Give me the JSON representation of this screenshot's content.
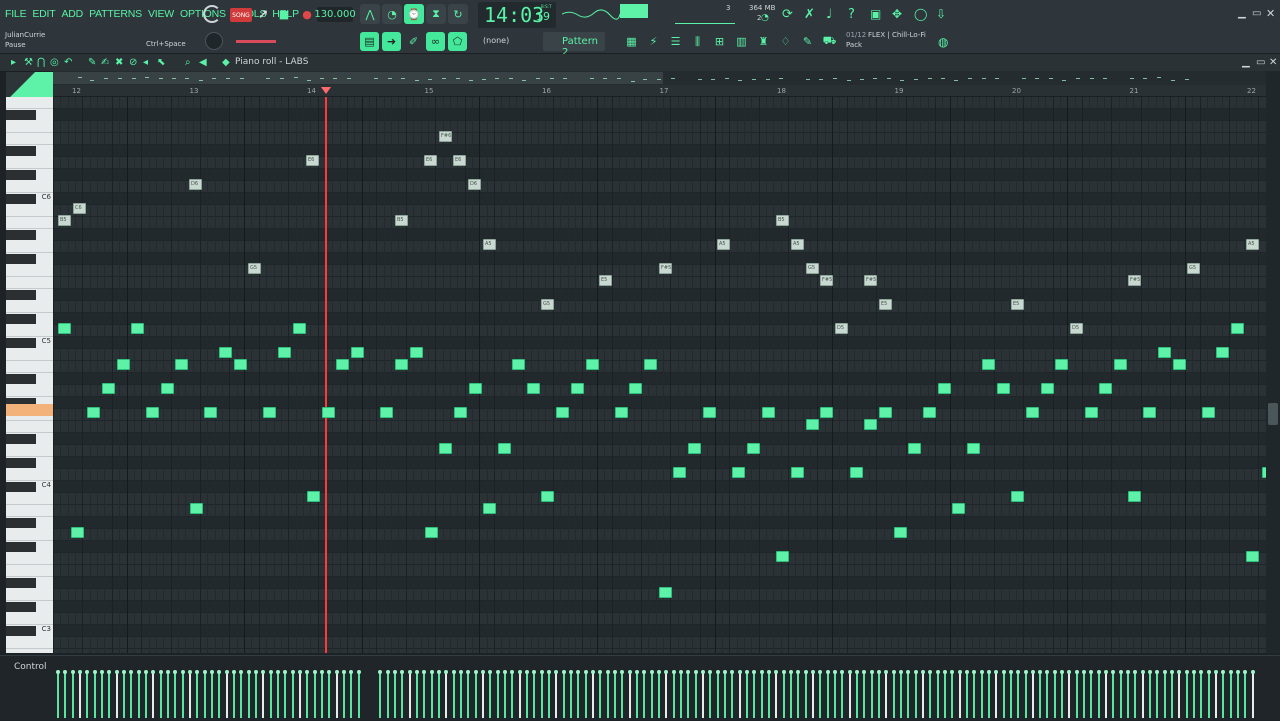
{
  "menu": [
    "FILE",
    "EDIT",
    "ADD",
    "PATTERNS",
    "VIEW",
    "OPTIONS",
    "TOOLS",
    "HELP"
  ],
  "transport": {
    "mode_label": "SONG",
    "tempo": "130.000",
    "time_main": "14:03",
    "time_sub": "19",
    "time_unit": "B:S:T"
  },
  "status": {
    "cpu_num": "3",
    "mem": "364 MB",
    "poly": "2"
  },
  "hint": {
    "user": "JulianCurrie",
    "state": "Pause",
    "shortcut": "Ctrl+Space"
  },
  "pattern": {
    "channel": "(none)",
    "name": "Pattern 2"
  },
  "flex": {
    "counter": "01/12",
    "preset": "FLEX | Chill-Lo-Fi",
    "pack": "Pack"
  },
  "pianoroll": {
    "title": "Piano roll - LABS",
    "control_label": "Control"
  },
  "ruler": [
    "12",
    "13",
    "14",
    "15",
    "16",
    "17",
    "18",
    "19",
    "20",
    "21",
    "22"
  ],
  "key_labels": [
    "C6",
    "C5",
    "C4",
    "C3"
  ],
  "ghost_labels": [
    "C6",
    "B5",
    "D6",
    "E6",
    "F#6",
    "E6",
    "E6",
    "D6",
    "B5",
    "A5",
    "G5",
    "A5",
    "F#5",
    "E5",
    "G5",
    "B5",
    "A5",
    "G5",
    "F#5",
    "F#5",
    "E5",
    "D5",
    "E5",
    "D5",
    "F#5",
    "G5",
    "A5"
  ],
  "colors": {
    "accent": "#5df2a8",
    "playhead": "#ff3a3a",
    "selected_key": "#f2b27a"
  }
}
